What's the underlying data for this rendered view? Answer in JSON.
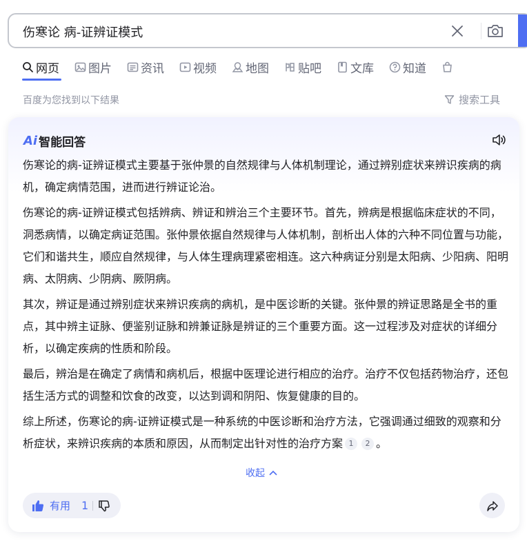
{
  "search": {
    "query": "伤寒论 病-证辨证模式"
  },
  "tabs": [
    {
      "label": "网页",
      "icon": "search-icon",
      "active": true
    },
    {
      "label": "图片",
      "icon": "image-icon"
    },
    {
      "label": "资讯",
      "icon": "news-icon"
    },
    {
      "label": "视频",
      "icon": "video-icon"
    },
    {
      "label": "地图",
      "icon": "map-icon"
    },
    {
      "label": "贴吧",
      "icon": "tieba-icon"
    },
    {
      "label": "文库",
      "icon": "doc-icon"
    },
    {
      "label": "知道",
      "icon": "question-icon"
    }
  ],
  "result_count": "百度为您找到以下结果",
  "search_tools": "搜索工具",
  "ai": {
    "logo_mark": "Ai",
    "title": "智能回答",
    "paragraphs": [
      "伤寒论的病-证辨证模式主要基于张仲景的自然规律与人体机制理论，通过辨别症状来辨识疾病的病机，确定病情范围，进而进行辨证论治。",
      "伤寒论的病-证辨证模式包括辨病、辨证和辨治三个主要环节。首先，辨病是根据临床症状的不同，洞悉病情，以确定病证范围。张仲景依据自然规律与人体机制，剖析出人体的六种不同位置与功能，它们和谐共生，顺应自然规律，与人体生理病理紧密相连。这六种病证分别是太阳病、少阳病、阳明病、太阴病、少阴病、厥阴病。",
      "其次，辨证是通过辨别症状来辨识疾病的病机，是中医诊断的关键。张仲景的辨证思路是全书的重点，其中辨主证脉、便鉴别证脉和辨兼证脉是辨证的三个重要方面。这一过程涉及对症状的详细分析，以确定疾病的性质和阶段。",
      "最后，辨治是在确定了病情和病机后，根据中医理论进行相应的治疗。治疗不仅包括药物治疗，还包括生活方式的调整和饮食的改变，以达到调和阴阳、恢复健康的目的。"
    ],
    "last_paragraph": "综上所述，伤寒论的病-证辨证模式是一种系统的中医诊断和治疗方法，它强调通过细致的观察和分析症状，来辨识疾病的本质和原因，从而制定出针对性的治疗方案",
    "citations": [
      "1",
      "2"
    ],
    "last_punct": "。",
    "collapse_label": "收起",
    "useful_label": "有用",
    "useful_count": "1"
  },
  "colors": {
    "accent": "#4e6ef2",
    "muted": "#9195a3",
    "text": "#222226"
  }
}
